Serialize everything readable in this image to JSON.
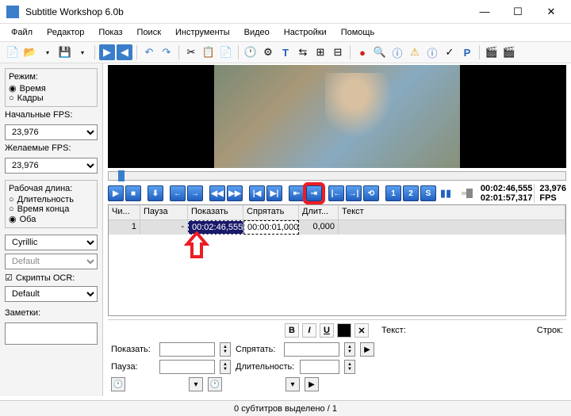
{
  "title": "Subtitle Workshop 6.0b",
  "menu": [
    "Файл",
    "Редактор",
    "Показ",
    "Поиск",
    "Инструменты",
    "Видео",
    "Настройки",
    "Помощь"
  ],
  "sidebar": {
    "mode_label": "Режим:",
    "mode_time": "Время",
    "mode_frames": "Кадры",
    "initial_fps_label": "Начальные FPS:",
    "initial_fps": "23,976",
    "desired_fps_label": "Желаемые FPS:",
    "desired_fps": "23,976",
    "worklen_label": "Рабочая длина:",
    "wl_duration": "Длительность",
    "wl_end": "Время конца",
    "wl_both": "Оба",
    "enc1": "Cyrillic",
    "enc2": "Default",
    "ocr_label": "Скрипты OCR:",
    "ocr": "Default",
    "notes_label": "Заметки:"
  },
  "pb": {
    "one": "1",
    "two": "2",
    "s": "S"
  },
  "time": {
    "t1": "00:02:46,555",
    "t2": "02:01:57,317",
    "fps": "23,976",
    "fpslbl": "FPS"
  },
  "grid": {
    "headers": [
      "Чи...",
      "Пауза",
      "Показать",
      "Спрятать",
      "Длит...",
      "Текст"
    ],
    "row": {
      "num": "1",
      "pause": "-",
      "show": "00:02:46,555",
      "hide": "00:00:01,000",
      "dur": "0,000",
      "text": ""
    }
  },
  "ed": {
    "show": "Показать:",
    "hide": "Спрятать:",
    "pause": "Пауза:",
    "dur": "Длительность:",
    "text": "Текст:",
    "lines": "Строк:"
  },
  "status": "0 субтитров выделено / 1"
}
